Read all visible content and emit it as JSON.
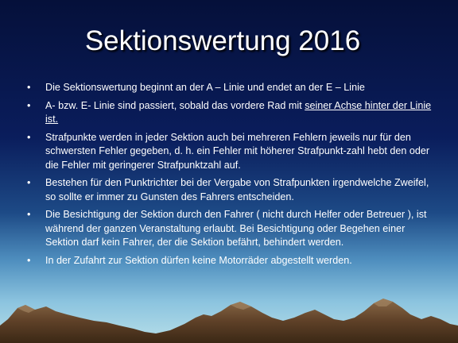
{
  "slide": {
    "title": "Sektionswertung 2016",
    "bullet_symbol": "•",
    "bullets": [
      {
        "text": "Die Sektionswertung beginnt an der A – Linie und endet an der E – Linie",
        "underlined": ""
      },
      {
        "text": "A- bzw. E- Linie sind passiert, sobald das vordere Rad mit ",
        "underlined": "seiner Achse hinter der Linie ist."
      },
      {
        "text": "Strafpunkte werden in jeder Sektion auch bei mehreren Fehlern jeweils nur für den schwersten Fehler gegeben, d. h. ein Fehler mit höherer Strafpunkt-zahl hebt den oder die Fehler mit geringerer Strafpunktzahl auf.",
        "underlined": ""
      },
      {
        "text": "Bestehen für den Punktrichter bei der Vergabe von Strafpunkten irgendwelche Zweifel, so sollte er immer zu Gunsten des Fahrers entscheiden.",
        "underlined": ""
      },
      {
        "text": "Die Besichtigung der Sektion durch den Fahrer ( nicht durch Helfer oder Betreuer ), ist während der ganzen Veranstaltung erlaubt. Bei Besichtigung oder Begehen einer Sektion darf kein Fahrer, der die Sektion befährt, behindert werden.",
        "underlined": ""
      },
      {
        "text": "In der Zufahrt zur Sektion dürfen keine Motorräder abgestellt werden.",
        "underlined": ""
      }
    ]
  },
  "colors": {
    "text": "#ffffff",
    "sky_top": "#05103a",
    "horizon": "#b7dfe9",
    "mountain": "#6b4a2e"
  }
}
